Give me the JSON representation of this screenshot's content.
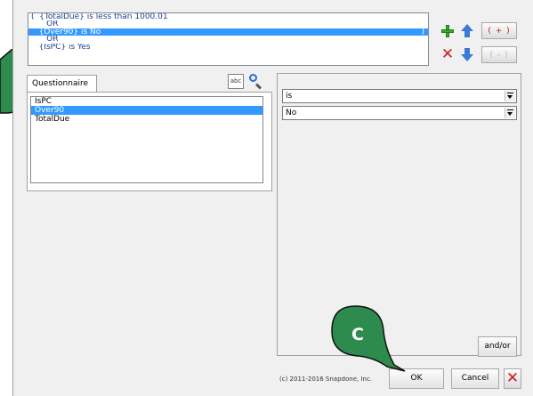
{
  "criteria": {
    "lines": [
      {
        "text": "(  {TotalDue} is less than 1000.01",
        "selected": false
      },
      {
        "text": "      OR",
        "selected": false
      },
      {
        "text": "   {Over90} is No",
        "selected": true,
        "suffix": ")"
      },
      {
        "text": "      OR",
        "selected": false
      },
      {
        "text": "   {IsPC} is Yes",
        "selected": false
      }
    ]
  },
  "toolbar": {
    "add_group_label": "( + )",
    "remove_group_label": "( - )"
  },
  "field_panel": {
    "tab_label": "Questionnaire",
    "abc_label": "abc",
    "fields": [
      "IsPC",
      "Over90",
      "TotalDue"
    ],
    "selected_index": 1
  },
  "condition": {
    "operator": "is",
    "value": "No"
  },
  "buttons": {
    "andor": "and/or",
    "ok": "OK",
    "cancel": "Cancel"
  },
  "copyright": "(c) 2011-2016 Snapdone, Inc.",
  "callouts": {
    "c": "C"
  }
}
